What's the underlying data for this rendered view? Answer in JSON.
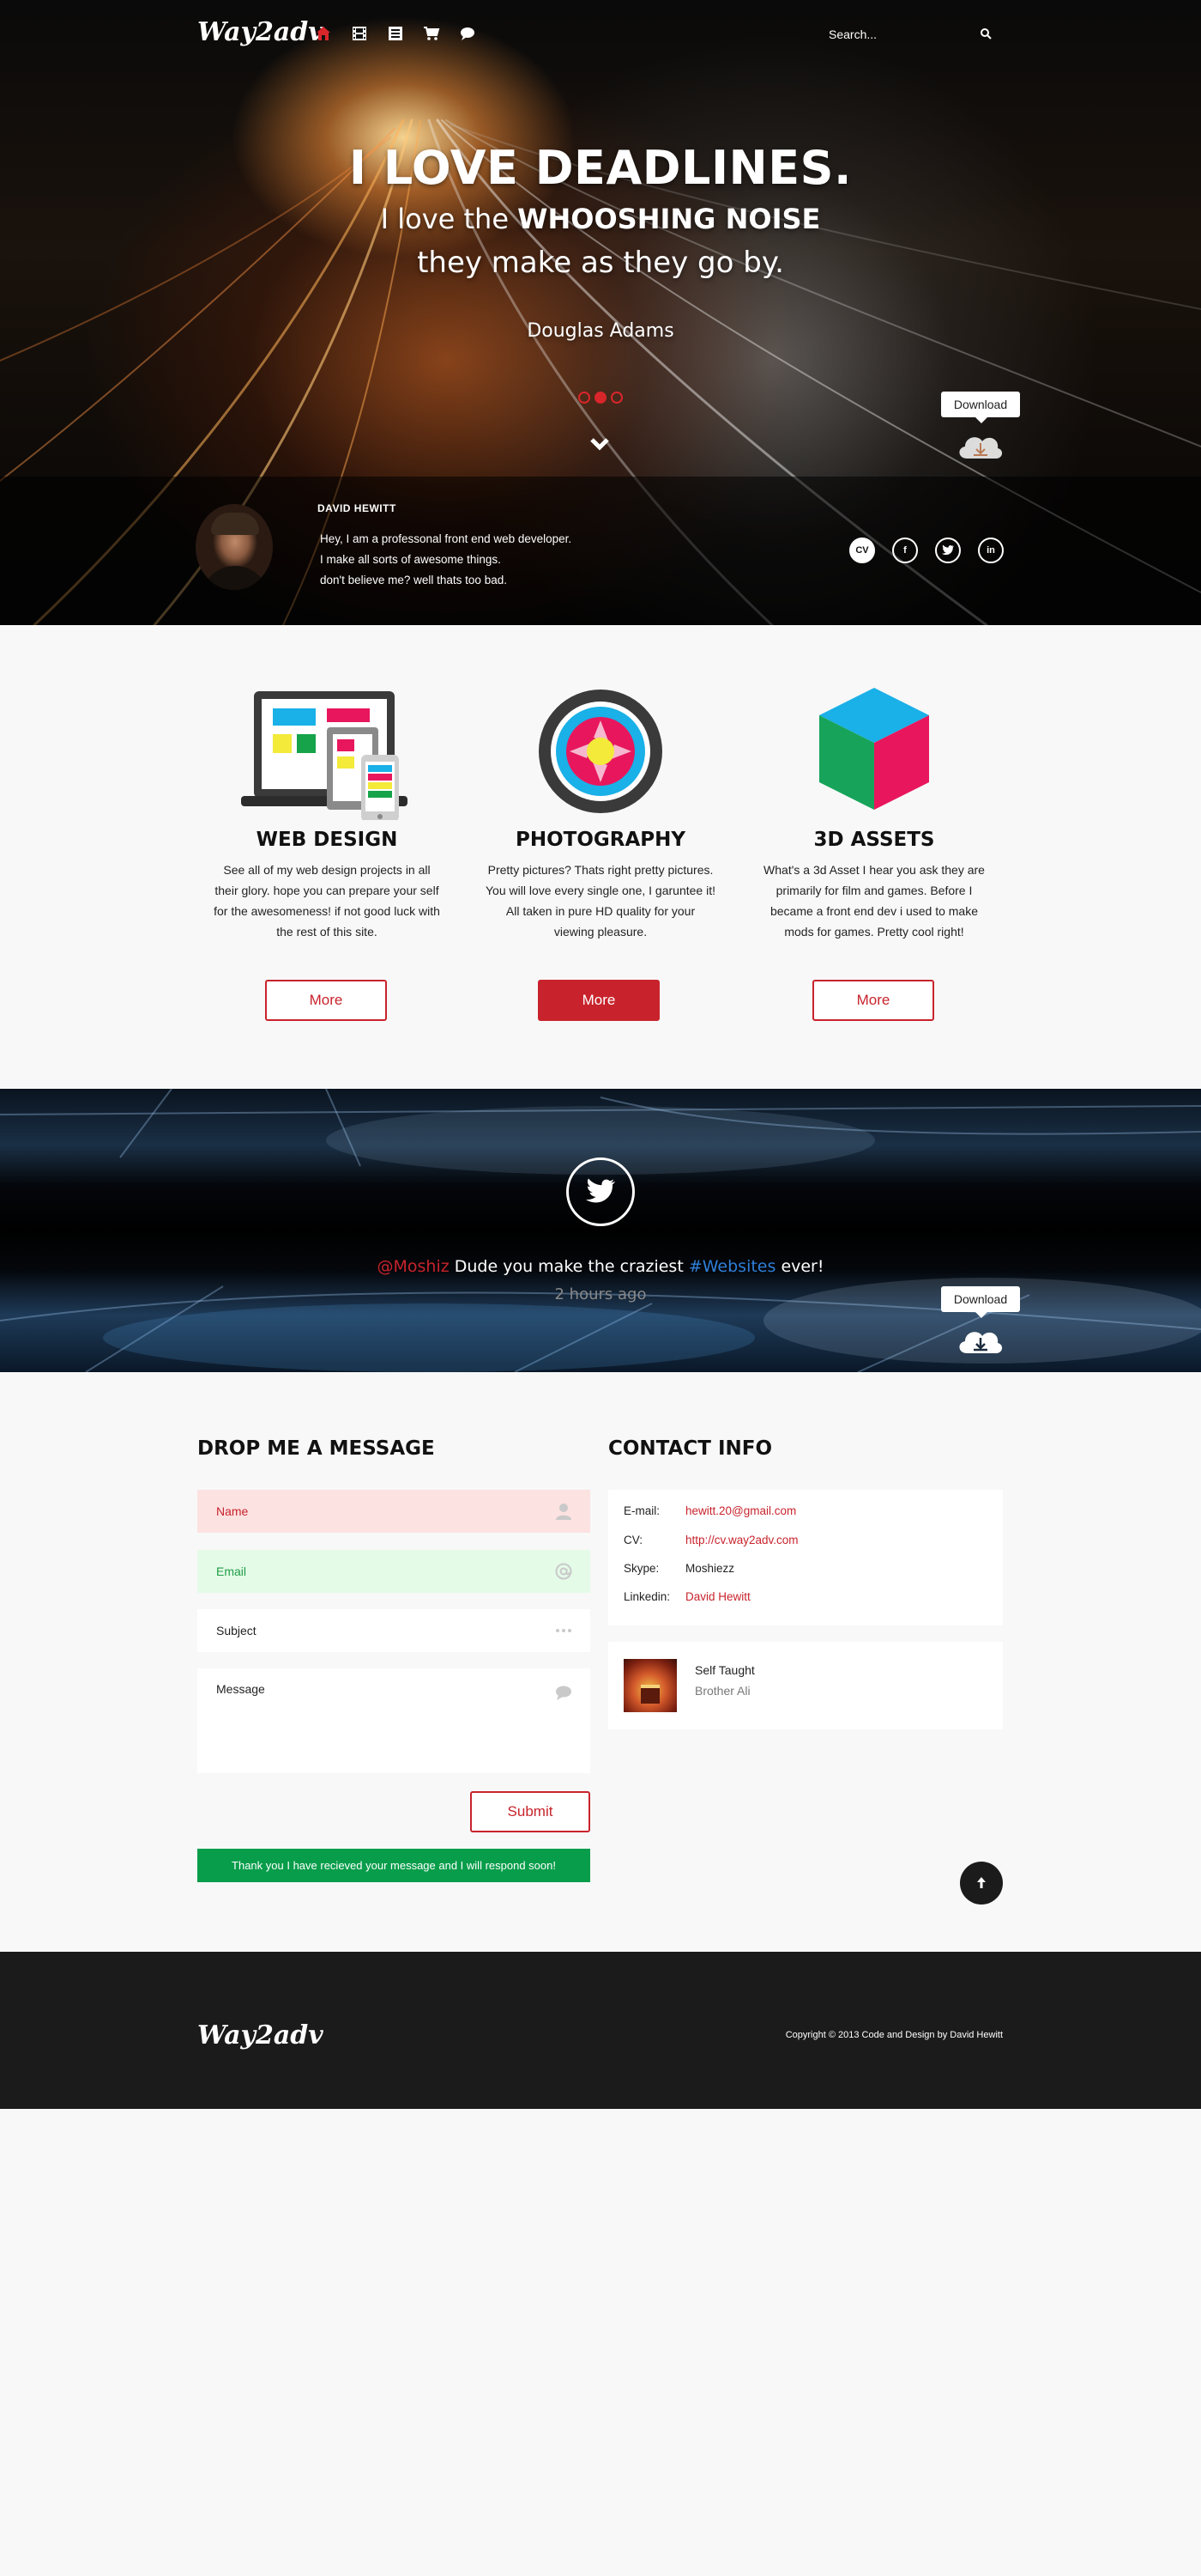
{
  "header": {
    "logo": "Way2adv",
    "nav_icons": [
      "home-icon",
      "film-icon",
      "list-icon",
      "cart-icon",
      "chat-icon"
    ],
    "search_placeholder": "Search..."
  },
  "hero": {
    "line1": "I LOVE DEADLINES.",
    "line2_prefix": "I love the",
    "line2_bold": "WHOOSHING NOISE",
    "line3": "they make as they go by.",
    "author": "Douglas Adams",
    "slider_dots": 3,
    "active_dot": 2,
    "download_label": "Download"
  },
  "profile": {
    "name": "DAVID HEWITT",
    "bio": [
      "Hey, I am a professonal front end web developer.",
      "I make all sorts of awesome things.",
      "don't believe me? well thats too bad."
    ],
    "socials": [
      "CV",
      "f",
      "twitter",
      "in"
    ]
  },
  "services": [
    {
      "title": "WEB DESIGN",
      "description": "See all of my web design projects in all their glory. hope you can prepare your self for the awesomeness! if not good luck with the rest of this site.",
      "button": "More"
    },
    {
      "title": "PHOTOGRAPHY",
      "description": "Pretty pictures? Thats right pretty pictures. You will love every single one, I garuntee it! All taken in pure HD quality for your viewing pleasure.",
      "button": "More"
    },
    {
      "title": "3D ASSETS",
      "description": "What's a 3d Asset I hear you ask they are primarily for film and games. Before I became a front end dev i used to make mods for games. Pretty cool right!",
      "button": "More"
    }
  ],
  "tweet": {
    "mention": "@Moshiz",
    "text": "Dude you make the craziest",
    "hashtag": "#Websites",
    "suffix": "ever!",
    "time": "2 hours ago",
    "download_label": "Download"
  },
  "contact_form": {
    "title": "DROP ME A MESSAGE",
    "name_placeholder": "Name",
    "email_placeholder": "Email",
    "subject_placeholder": "Subject",
    "message_placeholder": "Message",
    "submit": "Submit",
    "success": "Thank you I have recieved your message and I will respond soon!"
  },
  "contact_info": {
    "title": "CONTACT INFO",
    "rows": [
      {
        "label": "E-mail:",
        "value": "hewitt.20@gmail.com"
      },
      {
        "label": "CV:",
        "value": "http://cv.way2adv.com"
      },
      {
        "label": "Skype:",
        "value": "Moshiezz"
      },
      {
        "label": "Linkedin:",
        "value": "David Hewitt"
      }
    ],
    "song_title": "Self Taught",
    "song_artist": "Brother Ali"
  },
  "footer": {
    "logo": "Way2adv",
    "copyright": "Copyright © 2013 Code and Design by David Hewitt"
  },
  "colors": {
    "accent_red": "#c8232c",
    "success_green": "#079d4a",
    "dark": "#1b1b1b",
    "hashtag_blue": "#2f7fd8"
  }
}
